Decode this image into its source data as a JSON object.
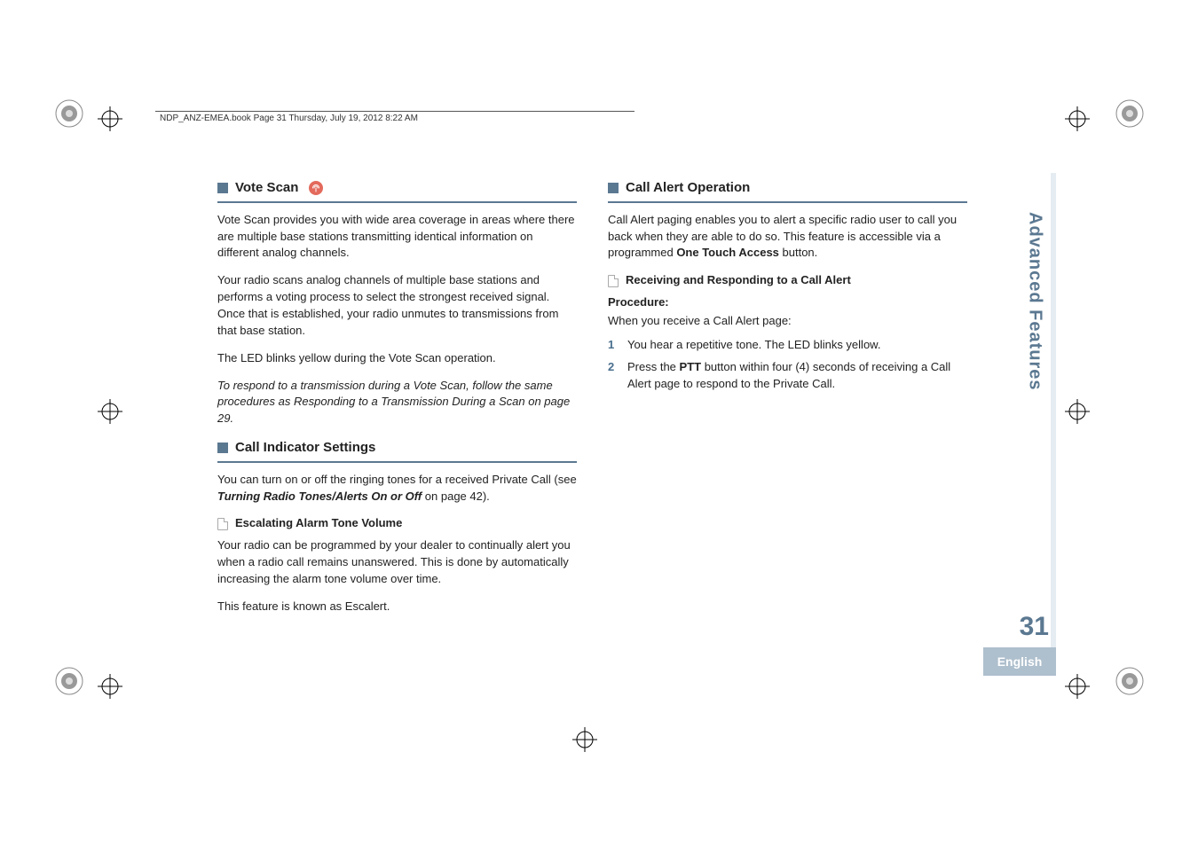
{
  "header": {
    "running_head": "NDP_ANZ-EMEA.book  Page 31  Thursday, July 19, 2012  8:22 AM"
  },
  "left": {
    "vote_scan": {
      "title": "Vote Scan",
      "p1": "Vote Scan provides you with wide area coverage in areas where there are multiple base stations transmitting identical information on different analog channels.",
      "p2": "Your radio scans analog channels of multiple base stations and performs a voting process to select the strongest received signal. Once that is established, your radio unmutes to transmissions from that base station.",
      "p3": "The LED blinks yellow during the Vote Scan operation.",
      "p4": "To respond to a transmission during a Vote Scan, follow the same procedures as Responding to a Transmission During a Scan on page 29."
    },
    "call_indicator": {
      "title": "Call Indicator Settings",
      "p1a": "You can turn on or off the ringing tones for a received Private Call (see ",
      "p1b": "Turning Radio Tones/Alerts On or Off",
      "p1c": " on page 42).",
      "sub_title": "Escalating Alarm Tone Volume",
      "p2": "Your radio can be programmed by your dealer to continually alert you when a radio call remains unanswered. This is done by automatically increasing the alarm tone volume over time.",
      "p3": "This feature is known as Escalert."
    }
  },
  "right": {
    "call_alert": {
      "title": "Call Alert Operation",
      "p1a": "Call Alert paging enables you to alert a specific radio user to call you back when they are able to do so. This feature is accessible via a programmed ",
      "p1b": "One Touch Access",
      "p1c": " button.",
      "sub_title": "Receiving and Responding to a Call Alert",
      "proc_label": "Procedure:",
      "proc_intro": "When you receive a Call Alert page:",
      "steps": {
        "n1": "1",
        "t1": "You hear a repetitive tone. The LED blinks yellow.",
        "n2": "2",
        "t2a": "Press the ",
        "t2b": "PTT",
        "t2c": " button within four (4) seconds of receiving a Call Alert page to respond to the Private Call."
      }
    }
  },
  "side": {
    "tab": "Advanced Features",
    "page_number": "31",
    "language": "English"
  }
}
